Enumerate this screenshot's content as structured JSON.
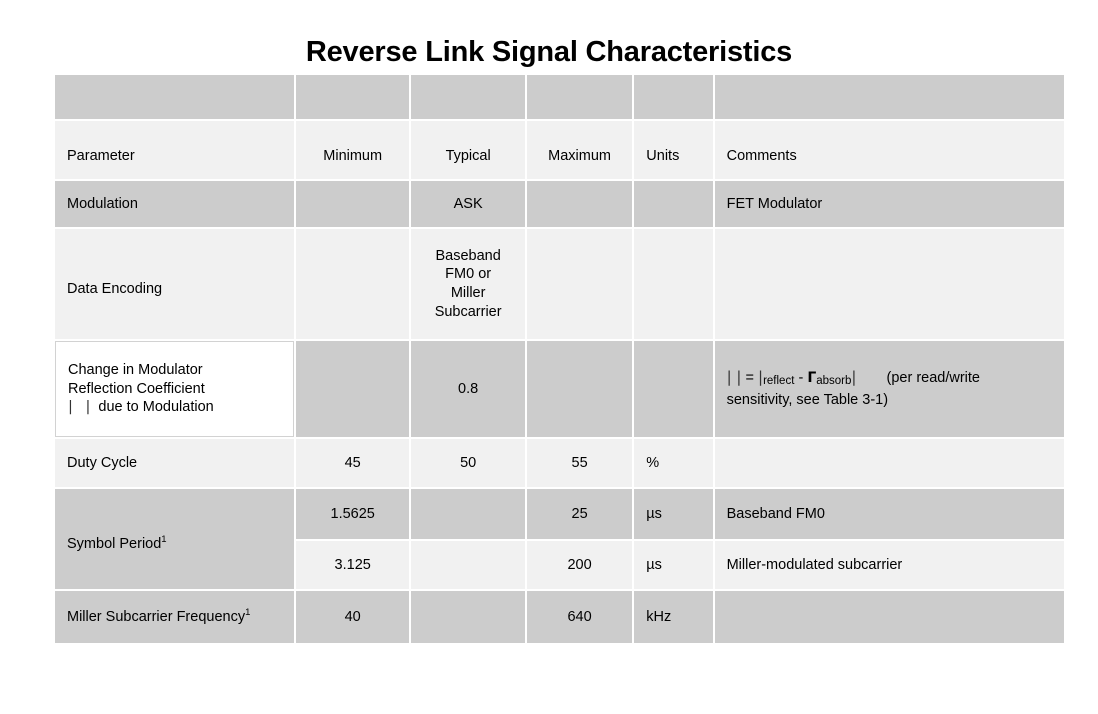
{
  "document": {
    "title": "Reverse Link Signal Characteristics"
  },
  "table": {
    "columns": [
      {
        "key": "parameter",
        "label": "Parameter"
      },
      {
        "key": "minimum",
        "label": "Minimum"
      },
      {
        "key": "typical",
        "label": "Typical"
      },
      {
        "key": "maximum",
        "label": "Maximum"
      },
      {
        "key": "units",
        "label": "Units"
      },
      {
        "key": "comments",
        "label": "Comments"
      }
    ],
    "rows": [
      {
        "id": "modulation",
        "parameter": "Modulation",
        "minimum": "",
        "typical": "ASK",
        "maximum": "",
        "units": "",
        "comments": "FET Modulator",
        "shade": "dark"
      },
      {
        "id": "data-encoding",
        "parameter": "Data Encoding",
        "minimum": "",
        "typical_lines": [
          "Baseband",
          "FM0 or",
          "Miller",
          "Subcarrier"
        ],
        "typical": "Baseband FM0 or Miller Subcarrier",
        "maximum": "",
        "units": "",
        "comments": "",
        "shade": "light"
      },
      {
        "id": "reflection-coefficient",
        "parameter_lines": [
          "Change in Modulator",
          "Reflection Coefficient",
          "| | due to Modulation"
        ],
        "parameter": "Change in Modulator Reflection Coefficient | | due to Modulation",
        "parameter_bars": "| |",
        "parameter_tail": "due to Modulation",
        "minimum": "",
        "typical": "0.8",
        "maximum": "",
        "units": "",
        "comments_formula": {
          "bars_lhs": "| |",
          "equals": "=",
          "bar_open": "|",
          "sub1": "reflect",
          "minus": "-",
          "gamma": "Γ",
          "sub2": "absorb",
          "bar_close": "|"
        },
        "comments_note_line1": "(per read/write",
        "comments_note_line2": "sensitivity, see Table 3-1)",
        "comments": "| | = | reflect - Γabsorb|   (per read/write sensitivity, see Table 3-1)",
        "shade": "dark"
      },
      {
        "id": "duty-cycle",
        "parameter": "Duty Cycle",
        "minimum": "45",
        "typical": "50",
        "maximum": "55",
        "units": "%",
        "comments": "",
        "shade": "light"
      },
      {
        "id": "symbol-period-fm0",
        "parameter": "Symbol Period",
        "parameter_superscript": "1",
        "minimum": "1.5625",
        "typical": "",
        "maximum": "25",
        "units": "µs",
        "comments": "Baseband FM0",
        "shade": "dark"
      },
      {
        "id": "symbol-period-miller",
        "parameter": "",
        "minimum": "3.125",
        "typical": "",
        "maximum": "200",
        "units": "µs",
        "comments": "Miller-modulated subcarrier",
        "shade": "light"
      },
      {
        "id": "miller-subcarrier-frequency",
        "parameter": "Miller Subcarrier Frequency",
        "parameter_superscript": "1",
        "minimum": "40",
        "typical": "",
        "maximum": "640",
        "units": "kHz",
        "comments": "",
        "shade": "dark"
      }
    ]
  },
  "colors": {
    "row_dark": "#cccccc",
    "row_light": "#f1f1f1",
    "cell_white": "#ffffff",
    "page_background": "#ffffff",
    "text": "#000000"
  }
}
